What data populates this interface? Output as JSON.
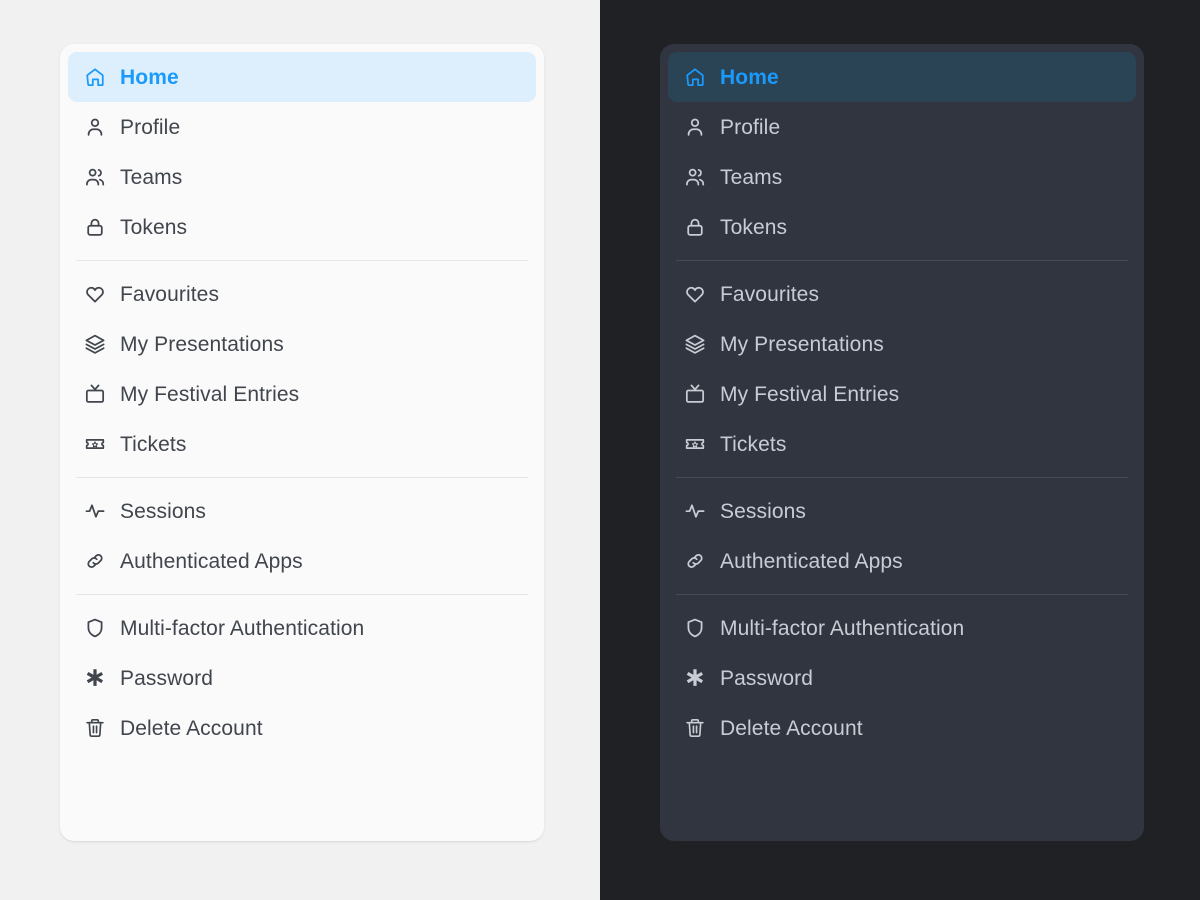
{
  "themes": [
    {
      "name": "light",
      "background": "#f1f1f1",
      "card_background": "#fafafa",
      "text_color": "#41454d",
      "accent_color": "#1a9bfc",
      "active_background": "#ddeefc",
      "divider_color": "#e6e6e6"
    },
    {
      "name": "dark",
      "background": "#1f2125",
      "card_background": "#31353f",
      "text_color": "#c8ccd4",
      "accent_color": "#1a9bfc",
      "active_background": "#2a4355",
      "divider_color": "#464b57"
    }
  ],
  "nav": {
    "groups": [
      {
        "items": [
          {
            "label": "Home",
            "icon": "home-icon",
            "active": true
          },
          {
            "label": "Profile",
            "icon": "user-icon",
            "active": false
          },
          {
            "label": "Teams",
            "icon": "users-icon",
            "active": false
          },
          {
            "label": "Tokens",
            "icon": "lock-icon",
            "active": false
          }
        ]
      },
      {
        "items": [
          {
            "label": "Favourites",
            "icon": "heart-icon",
            "active": false
          },
          {
            "label": "My Presentations",
            "icon": "layers-icon",
            "active": false
          },
          {
            "label": "My Festival Entries",
            "icon": "tv-icon",
            "active": false
          },
          {
            "label": "Tickets",
            "icon": "ticket-icon",
            "active": false
          }
        ]
      },
      {
        "items": [
          {
            "label": "Sessions",
            "icon": "activity-icon",
            "active": false
          },
          {
            "label": "Authenticated Apps",
            "icon": "link-icon",
            "active": false
          }
        ]
      },
      {
        "items": [
          {
            "label": "Multi-factor Authentication",
            "icon": "shield-icon",
            "active": false
          },
          {
            "label": "Password",
            "icon": "asterisk-icon",
            "active": false
          },
          {
            "label": "Delete Account",
            "icon": "trash-icon",
            "active": false
          }
        ]
      }
    ]
  }
}
